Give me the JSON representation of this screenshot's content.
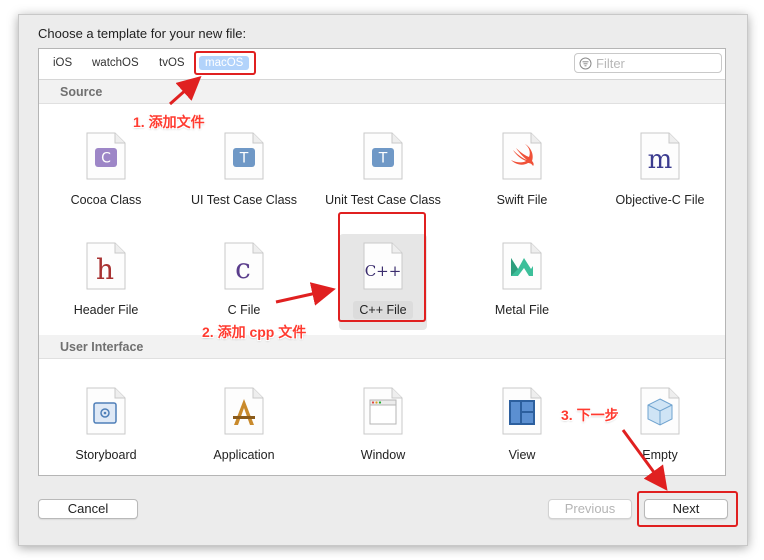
{
  "dialog": {
    "prompt": "Choose a template for your new file:",
    "platform_tabs": [
      "iOS",
      "watchOS",
      "tvOS",
      "macOS"
    ],
    "selected_platform": "macOS",
    "filter_placeholder": "Filter"
  },
  "sections": {
    "source": {
      "title": "Source",
      "items": [
        {
          "label": "Cocoa Class",
          "icon": "cocoa-class-icon"
        },
        {
          "label": "UI Test Case Class",
          "icon": "ui-test-case-icon"
        },
        {
          "label": "Unit Test Case Class",
          "icon": "unit-test-case-icon"
        },
        {
          "label": "Swift File",
          "icon": "swift-file-icon"
        },
        {
          "label": "Objective-C File",
          "icon": "objc-file-icon"
        },
        {
          "label": "Header File",
          "icon": "header-file-icon"
        },
        {
          "label": "C File",
          "icon": "c-file-icon"
        },
        {
          "label": "C++ File",
          "icon": "cpp-file-icon",
          "selected": true
        },
        {
          "label": "Metal File",
          "icon": "metal-file-icon"
        }
      ]
    },
    "user_interface": {
      "title": "User Interface",
      "items": [
        {
          "label": "Storyboard",
          "icon": "storyboard-icon"
        },
        {
          "label": "Application",
          "icon": "application-icon"
        },
        {
          "label": "Window",
          "icon": "window-icon"
        },
        {
          "label": "View",
          "icon": "view-icon"
        },
        {
          "label": "Empty",
          "icon": "empty-icon"
        }
      ]
    }
  },
  "icon_letters": {
    "cocoa": "C",
    "ui_test": "T",
    "unit_test": "T",
    "objc": "m",
    "header": "h",
    "c": "c",
    "cpp": "C++"
  },
  "buttons": {
    "cancel": "Cancel",
    "previous": "Previous",
    "next": "Next"
  },
  "annotations": {
    "step1": "1. 添加文件",
    "step2": "2. 添加 cpp 文件",
    "step3": "3. 下一步"
  },
  "colors": {
    "annotation_red": "#e02020",
    "selection_blue": "#b2d3fb"
  }
}
